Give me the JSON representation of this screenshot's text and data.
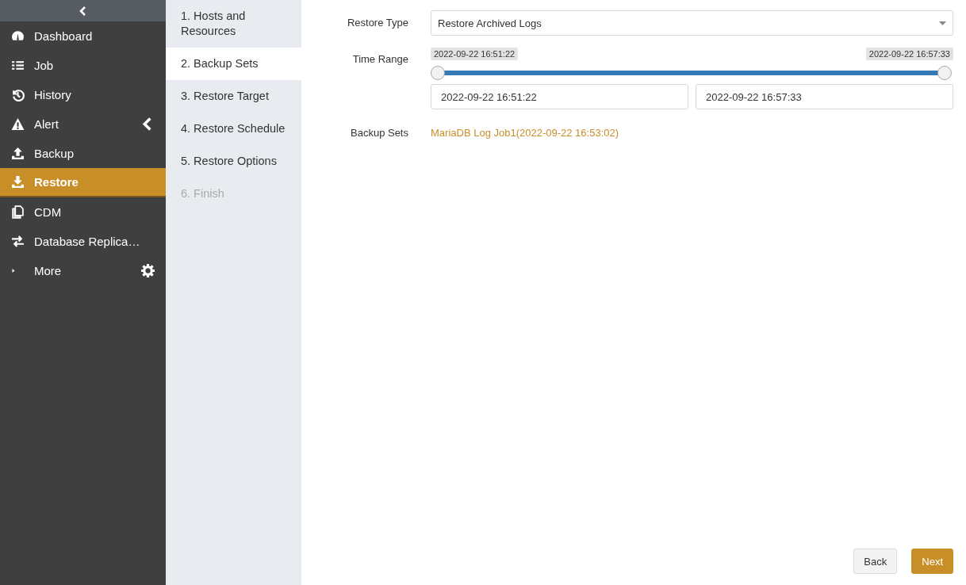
{
  "sidebar": {
    "items": [
      {
        "label": "Dashboard",
        "selected": false,
        "submenu": false
      },
      {
        "label": "Job",
        "selected": false,
        "submenu": false
      },
      {
        "label": "History",
        "selected": false,
        "submenu": false
      },
      {
        "label": "Alert",
        "selected": false,
        "submenu": true
      },
      {
        "label": "Backup",
        "selected": false,
        "submenu": false
      },
      {
        "label": "Restore",
        "selected": true,
        "submenu": false
      },
      {
        "label": "CDM",
        "selected": false,
        "submenu": false
      },
      {
        "label": "Database Replica…",
        "selected": false,
        "submenu": false
      }
    ],
    "more": {
      "label": "More"
    }
  },
  "steps": [
    {
      "label": "1. Hosts and Resources",
      "selected": false,
      "disabled": false
    },
    {
      "label": "2. Backup Sets",
      "selected": true,
      "disabled": false
    },
    {
      "label": "3. Restore Target",
      "selected": false,
      "disabled": false
    },
    {
      "label": "4. Restore Schedule",
      "selected": false,
      "disabled": false
    },
    {
      "label": "5. Restore Options",
      "selected": false,
      "disabled": false
    },
    {
      "label": "6. Finish",
      "selected": false,
      "disabled": true
    }
  ],
  "form": {
    "restore_type": {
      "label": "Restore Type",
      "value": "Restore Archived Logs"
    },
    "time_range": {
      "label": "Time Range",
      "thumbs": [
        {
          "tooltip": "2022-09-22 16:51:22",
          "level": 0
        },
        {
          "tooltip": "2022-09-22 16:57:33",
          "level": 1
        }
      ],
      "start_value": "2022-09-22 16:51:22",
      "end_value": "2022-09-22 16:57:33"
    },
    "backup_sets": {
      "label": "Backup Sets",
      "value": "MariaDB Log Job1(2022-09-22 16:53:02)"
    }
  },
  "buttons": [
    {
      "label": "Back",
      "kind": "secondary"
    },
    {
      "label": "Next",
      "kind": "primary"
    }
  ]
}
